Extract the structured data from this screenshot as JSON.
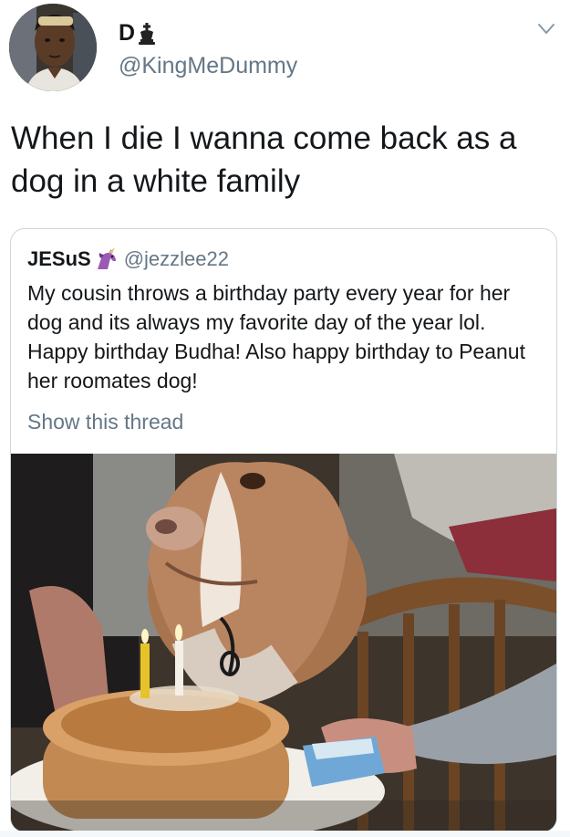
{
  "author": {
    "display_name": "D",
    "name_emoji_icon": "chess-king-icon",
    "handle": "@KingMeDummy",
    "avatar_icon": "profile-photo"
  },
  "menu_icon": "chevron-down-icon",
  "tweet": {
    "text": "When I die I wanna come back as a dog in a white family"
  },
  "quoted_tweet": {
    "display_name": "JESuS",
    "name_emoji_icon": "unicorn-icon",
    "handle": "@jezzlee22",
    "text": "My cousin throws a birthday party every year for her dog and its always my favorite day of the year lol. Happy birthday Budha! Also happy birthday to Peanut her roomates dog!",
    "show_thread_label": "Show this thread",
    "media_icon": "dog-birthday-cake-photo"
  },
  "colors": {
    "text": "#14171a",
    "secondary_text": "#657786",
    "card_border": "#ccd6dd",
    "unicorn_purple": "#9b59b6"
  }
}
